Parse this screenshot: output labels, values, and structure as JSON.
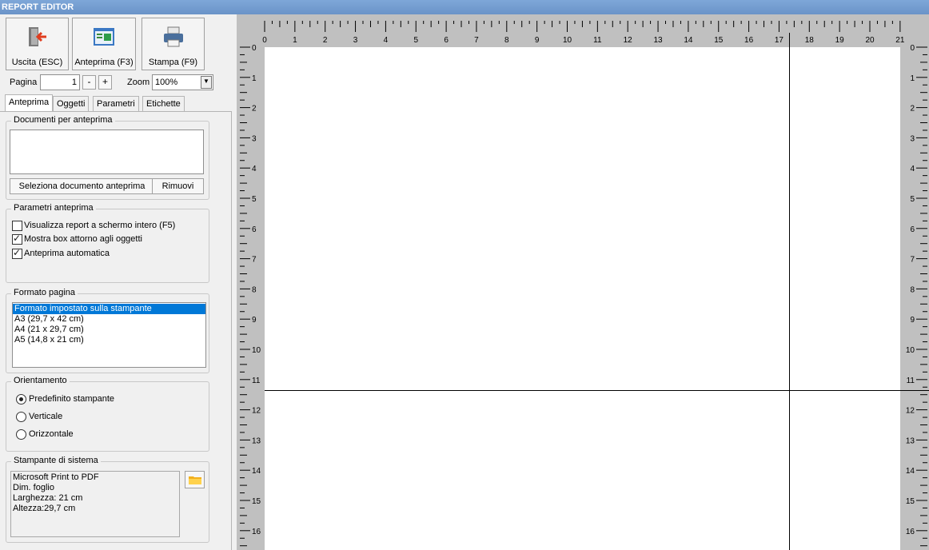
{
  "window": {
    "title": "REPORT EDITOR"
  },
  "toolbar": {
    "exit_label": "Uscita (ESC)",
    "preview_label": "Anteprima (F3)",
    "print_label": "Stampa (F9)"
  },
  "pager": {
    "page_label": "Pagina",
    "page_value": "1",
    "minus": "-",
    "plus": "+",
    "zoom_label": "Zoom",
    "zoom_value": "100%"
  },
  "tabs": [
    "Anteprima",
    "Oggetti",
    "Parametri",
    "Etichette"
  ],
  "preview_docs": {
    "title": "Documenti per anteprima",
    "select_button": "Seleziona documento anteprima",
    "remove_button": "Rimuovi"
  },
  "preview_params": {
    "title": "Parametri anteprima",
    "options": [
      {
        "label": "Visualizza report a schermo intero (F5)",
        "checked": false
      },
      {
        "label": "Mostra box attorno agli oggetti",
        "checked": true
      },
      {
        "label": "Anteprima automatica",
        "checked": true
      }
    ]
  },
  "page_format": {
    "title": "Formato pagina",
    "items": [
      "Formato impostato sulla stampante",
      "A3 (29,7 x 42 cm)",
      "A4 (21 x 29,7 cm)",
      "A5 (14,8 x 21 cm)"
    ],
    "selected_index": 0
  },
  "orientation": {
    "title": "Orientamento",
    "options": [
      "Predefinito stampante",
      "Verticale",
      "Orizzontale"
    ],
    "selected_index": 0
  },
  "system_printer": {
    "title": "Stampante di sistema",
    "lines": [
      "Microsoft Print to PDF",
      "Dim. foglio",
      "Larghezza: 21 cm",
      "Altezza:29,7 cm"
    ]
  },
  "rulers": {
    "horizontal_labels": [
      "0",
      "1",
      "2",
      "3",
      "4",
      "5",
      "6",
      "7",
      "8",
      "9",
      "10",
      "11",
      "12",
      "13",
      "14",
      "15",
      "16",
      "17",
      "18",
      "19",
      "20",
      "21"
    ],
    "vertical_labels": [
      "0",
      "1",
      "2",
      "3",
      "4",
      "5",
      "6",
      "7",
      "8",
      "9",
      "10",
      "11",
      "12",
      "13",
      "14",
      "15",
      "16"
    ]
  },
  "colors": {
    "selection": "#0078d7",
    "titlebar": "#6a93c8",
    "ruler_bg": "#c0c0c0"
  }
}
